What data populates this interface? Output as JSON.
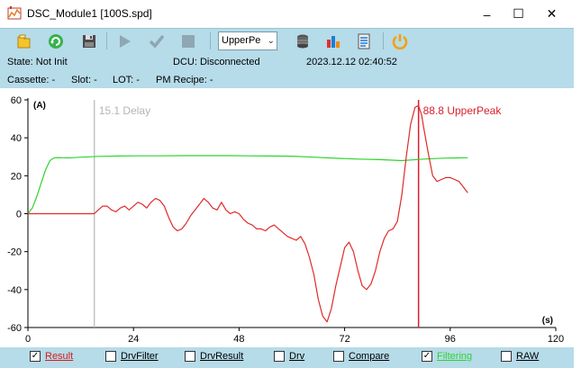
{
  "window": {
    "title": "DSC_Module1 [100S.spd]",
    "minimize_glyph": "–",
    "maximize_glyph": "☐",
    "close_glyph": "✕"
  },
  "toolbar": {
    "icons": [
      "open-folder-icon",
      "refresh-icon",
      "save-disk-icon",
      "play-icon",
      "check-icon",
      "stop-icon",
      "database-icon",
      "bar-chart-icon",
      "list-document-icon",
      "power-icon"
    ],
    "mode_select_value": "UpperPe"
  },
  "status": {
    "state": "State: Not Init",
    "dcu": "DCU: Disconnected",
    "datetime": "2023.12.12 02:40:52",
    "cassette": "Cassette: -",
    "slot": "Slot: -",
    "lot": "LOT: -",
    "pm_recipe": "PM Recipe: -"
  },
  "chart_data": {
    "type": "line",
    "ylabel": "(A)",
    "xlabel": "(s)",
    "xlim": [
      0,
      120
    ],
    "ylim": [
      -60,
      60
    ],
    "x_ticks": [
      "0",
      "24",
      "48",
      "72",
      "96",
      "120"
    ],
    "y_ticks": [
      "60",
      "40",
      "20",
      "0",
      "-20",
      "-40",
      "-60"
    ],
    "grid": false,
    "markers": [
      {
        "label": "15.1 Delay",
        "x": 15.1,
        "color": "#b5b5b5"
      },
      {
        "label": "88.8 UpperPeak",
        "x": 88.8,
        "color": "#d8202c"
      }
    ],
    "series": [
      {
        "color": "#2ed42e",
        "x": [
          0,
          1,
          2,
          3,
          4,
          5,
          6,
          7,
          8,
          9,
          10,
          12,
          14,
          16,
          20,
          25,
          30,
          35,
          40,
          45,
          50,
          55,
          60,
          65,
          70,
          75,
          80,
          85,
          90,
          95,
          100
        ],
        "y": [
          0,
          3,
          9,
          16,
          23,
          28,
          29.5,
          29.6,
          29.5,
          29.4,
          29.5,
          29.8,
          30,
          30.2,
          30.4,
          30.5,
          30.5,
          30.6,
          30.6,
          30.6,
          30.5,
          30.4,
          30.3,
          29.8,
          29.2,
          28.8,
          28.5,
          28,
          28.8,
          29.3,
          29.5
        ]
      },
      {
        "color": "#e02a2a",
        "x": [
          0,
          15.1,
          16,
          17,
          18,
          19,
          20,
          21,
          22,
          23,
          24,
          25,
          26,
          27,
          28,
          29,
          30,
          31,
          32,
          33,
          34,
          35,
          36,
          37,
          38,
          39,
          40,
          41,
          42,
          43,
          44,
          45,
          46,
          47,
          48,
          49,
          50,
          51,
          52,
          53,
          54,
          55,
          56,
          57,
          58,
          59,
          60,
          61,
          62,
          63,
          64,
          65,
          66,
          67,
          68,
          69,
          70,
          71,
          72,
          73,
          74,
          75,
          76,
          77,
          78,
          79,
          80,
          81,
          82,
          83,
          84,
          85,
          86,
          87,
          88,
          88.8,
          89.5,
          90,
          91,
          92,
          93,
          94,
          95,
          96,
          97,
          98,
          99,
          100
        ],
        "y": [
          0,
          0,
          2,
          4,
          4,
          2,
          1,
          3,
          4,
          2,
          4,
          6,
          5,
          3,
          6,
          8,
          7,
          4,
          -2,
          -7,
          -9,
          -8,
          -5,
          -1,
          2,
          5,
          8,
          6,
          3,
          2,
          6,
          2,
          0,
          1,
          0,
          -3,
          -5,
          -6,
          -8,
          -8,
          -9,
          -7,
          -6,
          -8,
          -10,
          -12,
          -13,
          -14,
          -12,
          -16,
          -23,
          -32,
          -45,
          -54,
          -57,
          -50,
          -38,
          -28,
          -18,
          -15,
          -20,
          -30,
          -38,
          -40,
          -37,
          -30,
          -20,
          -13,
          -9,
          -8,
          -4,
          10,
          30,
          47,
          56,
          57,
          52,
          45,
          32,
          20,
          17,
          18,
          19,
          19,
          18,
          17,
          14,
          11
        ]
      }
    ]
  },
  "legend": [
    {
      "label": "Result",
      "checked": true,
      "color": "#d81a1a"
    },
    {
      "label": "DrvFilter",
      "checked": false,
      "color": "#000000"
    },
    {
      "label": "DrvResult",
      "checked": false,
      "color": "#000000"
    },
    {
      "label": "Drv",
      "checked": false,
      "color": "#000000"
    },
    {
      "label": "Compare",
      "checked": false,
      "color": "#000000"
    },
    {
      "label": "Filtering",
      "checked": true,
      "color": "#2ed42e"
    },
    {
      "label": "RAW",
      "checked": false,
      "color": "#000000"
    }
  ]
}
